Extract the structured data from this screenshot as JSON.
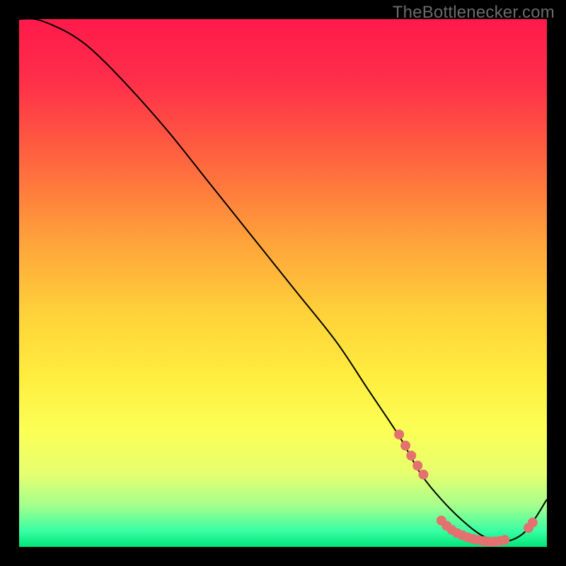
{
  "watermark": "TheBottlenecker.com",
  "chart_data": {
    "type": "line",
    "title": "",
    "xlabel": "",
    "ylabel": "",
    "xlim": [
      0,
      100
    ],
    "ylim": [
      0,
      100
    ],
    "grid": false,
    "legend": false,
    "background_gradient": {
      "stops": [
        {
          "offset": 0.0,
          "color": "#ff1a4b"
        },
        {
          "offset": 0.12,
          "color": "#ff2f49"
        },
        {
          "offset": 0.28,
          "color": "#ff6a3e"
        },
        {
          "offset": 0.42,
          "color": "#ffa23a"
        },
        {
          "offset": 0.56,
          "color": "#ffd23a"
        },
        {
          "offset": 0.68,
          "color": "#ffee3f"
        },
        {
          "offset": 0.78,
          "color": "#fbff56"
        },
        {
          "offset": 0.86,
          "color": "#e7ff6e"
        },
        {
          "offset": 0.92,
          "color": "#a7ff8c"
        },
        {
          "offset": 0.97,
          "color": "#38ffa3"
        },
        {
          "offset": 1.0,
          "color": "#00e57a"
        }
      ]
    },
    "series": [
      {
        "name": "curve",
        "color": "#000000",
        "width": 2,
        "x": [
          0,
          3,
          6,
          10,
          14,
          20,
          28,
          36,
          44,
          52,
          60,
          66,
          72,
          76,
          80,
          84,
          88,
          92,
          96,
          100
        ],
        "y": [
          100,
          100,
          99,
          97,
          94,
          88,
          79,
          69,
          59,
          49,
          39,
          30,
          21,
          14,
          9,
          5,
          2,
          1,
          3,
          9
        ]
      }
    ],
    "marker_clusters": [
      {
        "name": "segment-a",
        "color": "#e2716f",
        "x": [
          72.0,
          73.2,
          74.3,
          75.5,
          76.6
        ],
        "y": [
          21.3,
          19.2,
          17.3,
          15.4,
          13.7
        ]
      },
      {
        "name": "segment-b",
        "color": "#e2716f",
        "x": [
          80,
          81,
          82,
          83,
          84,
          85,
          86,
          87,
          88,
          89,
          90,
          91,
          92
        ],
        "y": [
          5,
          4,
          3.2,
          2.6,
          2.2,
          1.8,
          1.5,
          1.3,
          1.1,
          1.0,
          1.0,
          1.1,
          1.3
        ]
      },
      {
        "name": "segment-c",
        "color": "#e2716f",
        "x": [
          96.5,
          97.3
        ],
        "y": [
          3.6,
          4.6
        ]
      }
    ]
  }
}
